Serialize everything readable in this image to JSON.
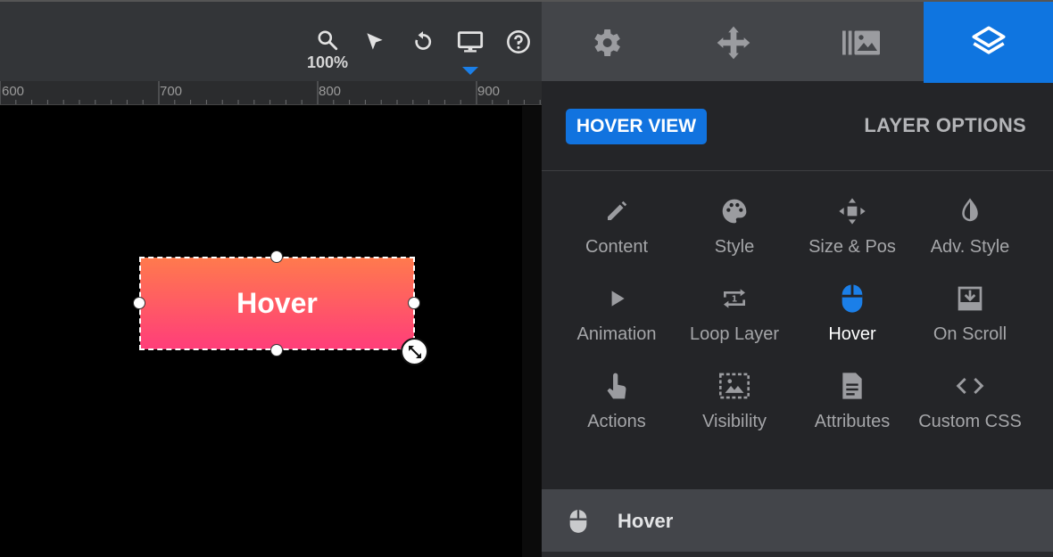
{
  "toolbar": {
    "zoom_level": "100%",
    "tools": [
      "search-icon",
      "pointer-icon",
      "undo-icon",
      "desktop-icon",
      "help-icon"
    ]
  },
  "ruler": {
    "labels": [
      "600",
      "700",
      "800",
      "900"
    ]
  },
  "canvas": {
    "layer_text": "Hover",
    "gradient_colors": [
      "#ff7a4d",
      "#ff3d7a"
    ]
  },
  "sidebar": {
    "tabs": [
      {
        "icon": "gear-icon",
        "active": false
      },
      {
        "icon": "move-arrows-icon",
        "active": false
      },
      {
        "icon": "gallery-icon",
        "active": false
      },
      {
        "icon": "layers-icon",
        "active": true
      }
    ],
    "badge": "HOVER VIEW",
    "title": "LAYER OPTIONS",
    "options": [
      {
        "label": "Content",
        "icon": "pencil-icon"
      },
      {
        "label": "Style",
        "icon": "palette-icon"
      },
      {
        "label": "Size & Pos",
        "icon": "move-icon"
      },
      {
        "label": "Adv. Style",
        "icon": "contrast-icon"
      },
      {
        "label": "Animation",
        "icon": "play-icon"
      },
      {
        "label": "Loop Layer",
        "icon": "loop-icon"
      },
      {
        "label": "Hover",
        "icon": "mouse-icon",
        "active": true
      },
      {
        "label": "On Scroll",
        "icon": "scroll-icon"
      },
      {
        "label": "Actions",
        "icon": "touch-icon"
      },
      {
        "label": "Visibility",
        "icon": "visibility-icon"
      },
      {
        "label": "Attributes",
        "icon": "document-icon"
      },
      {
        "label": "Custom CSS",
        "icon": "code-icon"
      }
    ],
    "section": {
      "label": "Hover",
      "icon": "mouse-icon"
    }
  },
  "colors": {
    "accent": "#0f75e0",
    "sidebar_bg": "#242528",
    "toolbar_bg": "#333538"
  }
}
